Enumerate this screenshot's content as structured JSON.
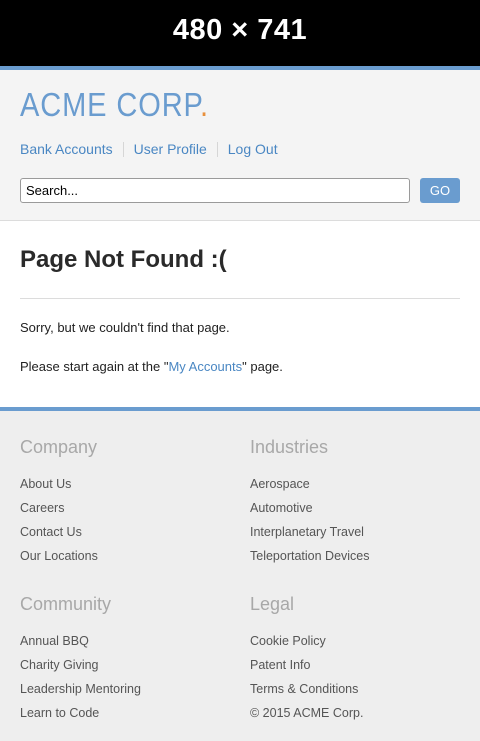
{
  "banner": {
    "text": "480 × 741"
  },
  "header": {
    "logo_main": "ACME CORP",
    "logo_dot": ".",
    "nav": [
      "Bank Accounts",
      "User Profile",
      "Log Out"
    ],
    "search": {
      "value": "Search...",
      "placeholder": "Search..."
    },
    "go_label": "GO"
  },
  "main": {
    "title": "Page Not Found :(",
    "message": "Sorry, but we couldn't find that page.",
    "restart_prefix": "Please start again at the \"",
    "restart_link": "My Accounts",
    "restart_suffix": "\" page."
  },
  "footer": {
    "company": {
      "heading": "Company",
      "items": [
        "About Us",
        "Careers",
        "Contact Us",
        "Our Locations"
      ]
    },
    "industries": {
      "heading": "Industries",
      "items": [
        "Aerospace",
        "Automotive",
        "Interplanetary Travel",
        "Teleportation Devices"
      ]
    },
    "community": {
      "heading": "Community",
      "items": [
        "Annual BBQ",
        "Charity Giving",
        "Leadership Mentoring",
        "Learn to Code"
      ]
    },
    "legal": {
      "heading": "Legal",
      "items": [
        "Cookie Policy",
        "Patent Info",
        "Terms & Conditions"
      ]
    },
    "copyright": "© 2015 ACME Corp."
  },
  "colors": {
    "accent": "#6a9ccf",
    "logo_dot": "#e8903c",
    "link": "#4a87c3"
  }
}
